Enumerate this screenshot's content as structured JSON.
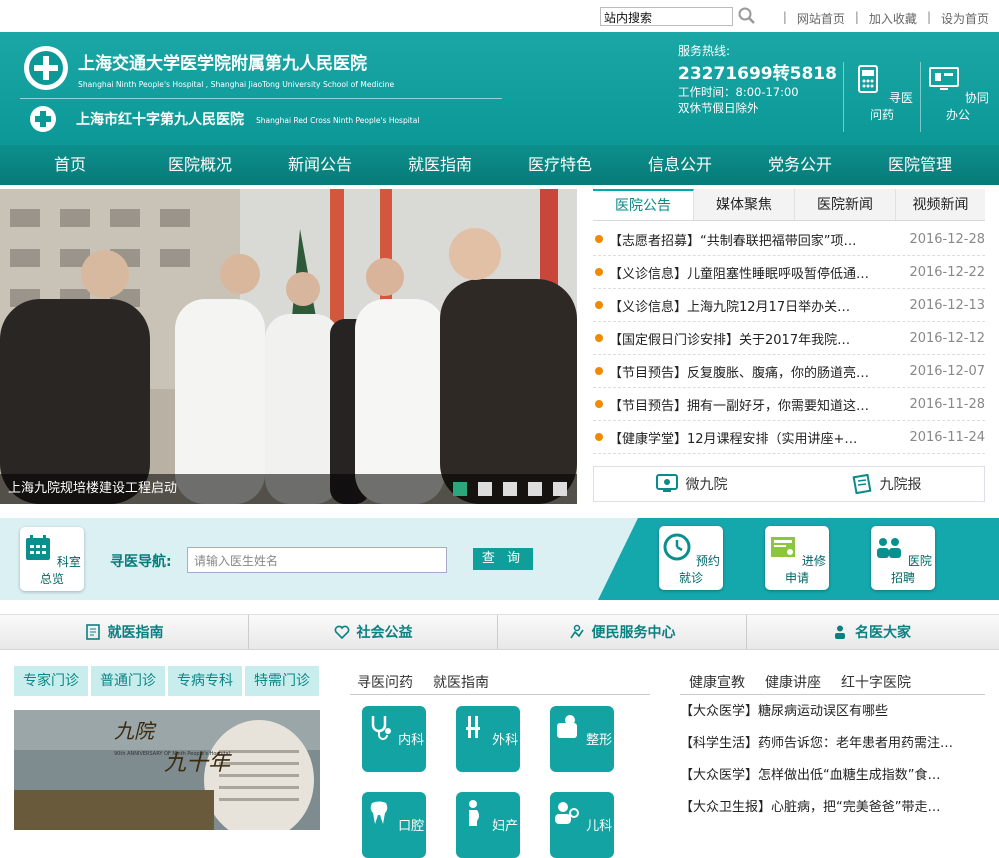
{
  "top": {
    "search_label": "站内搜索",
    "links": [
      "网站首页",
      "加入收藏",
      "设为首页"
    ],
    "separator": "|"
  },
  "header": {
    "hospital_name_cn": "上海交通大学医学院附属第九人民医院",
    "hospital_name_en": "Shanghai Ninth People's Hospital , Shanghai JiaoTong University School of Medicine",
    "red_cross_name_cn": "上海市红十字第九人民医院",
    "red_cross_name_en": "Shanghai Red Cross Ninth People's Hospital",
    "hotline_label": "服务热线:",
    "hotline_number": "23271699转5818",
    "work_hours": "工作时间：8:00-17:00",
    "holiday_note": "双休节假日除外",
    "buttons": [
      {
        "label": "寻医问药"
      },
      {
        "label": "协同办公"
      }
    ]
  },
  "nav": [
    "首页",
    "医院概况",
    "新闻公告",
    "就医指南",
    "医疗特色",
    "信息公开",
    "党务公开",
    "医院管理"
  ],
  "slider": {
    "caption": "上海九院规培楼建设工程启动",
    "dot_count": 5,
    "active_dot": 0
  },
  "news": {
    "tabs": [
      "医院公告",
      "媒体聚焦",
      "医院新闻",
      "视频新闻"
    ],
    "active_tab": 0,
    "items": [
      {
        "title": "【志愿者招募】“共制春联把福带回家”项…",
        "date": "2016-12-28"
      },
      {
        "title": "【义诊信息】儿童阻塞性睡眠呼吸暂停低通…",
        "date": "2016-12-22"
      },
      {
        "title": "【义诊信息】上海九院12月17日举办关…",
        "date": "2016-12-13"
      },
      {
        "title": "【国定假日门诊安排】关于2017年我院…",
        "date": "2016-12-12"
      },
      {
        "title": "【节目预告】反复腹胀、腹痛，你的肠道亮…",
        "date": "2016-12-07"
      },
      {
        "title": "【节目预告】拥有一副好牙，你需要知道这…",
        "date": "2016-11-28"
      },
      {
        "title": "【健康学堂】12月课程安排（实用讲座+…",
        "date": "2016-11-24"
      }
    ],
    "weixin": "微九院",
    "newspaper": "九院报"
  },
  "band": {
    "dept_overview": "科室总览",
    "find_label": "寻医导航:",
    "find_placeholder": "请输入医生姓名",
    "find_button": "查 询",
    "cards": [
      "预约就诊",
      "进修申请",
      "医院招聘"
    ]
  },
  "sections": [
    "就医指南",
    "社会公益",
    "便民服务中心",
    "名医大家"
  ],
  "clinic_tabs": [
    "专家门诊",
    "普通门诊",
    "专病专科",
    "特需门诊"
  ],
  "banner": {
    "text1": "九院",
    "text2": "九十年",
    "en": "90th ANNIVERSARY OF Ninth People's Hospital"
  },
  "middle": {
    "tabs": [
      "寻医问药",
      "就医指南"
    ],
    "depts": [
      "内科",
      "外科",
      "整形",
      "口腔",
      "妇产",
      "儿科"
    ]
  },
  "right": {
    "tabs": [
      "健康宣教",
      "健康讲座",
      "红十字医院"
    ],
    "items": [
      "【大众医学】糖尿病运动误区有哪些",
      "【科学生活】药师告诉您：老年患者用药需注…",
      "【大众医学】怎样做出低“血糖生成指数”食…",
      "【大众卫生报】心脏病，把“完美爸爸”带走…"
    ]
  },
  "colors": {
    "teal": "#0b9896",
    "nav": "#077b78",
    "accent_orange": "#f08a00",
    "dot_active": "#2aa77d"
  }
}
